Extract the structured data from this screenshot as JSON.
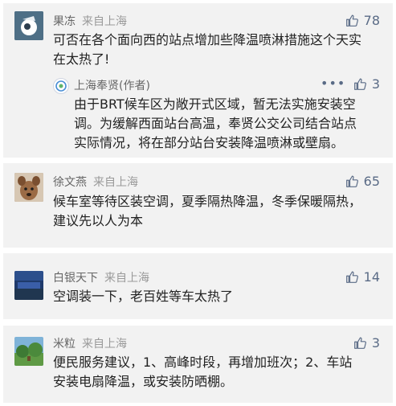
{
  "comments": [
    {
      "user": "果冻",
      "location": "来自上海",
      "likes": "78",
      "text_line1": "可否在各个面向西的站点增加些降温喷淋措施这个天实",
      "text_line2": "在太热了!",
      "reply": {
        "user": "上海奉贤(作者)",
        "menu": "•••",
        "likes": "3",
        "text_line1": "由于BRT候车区为敞开式区域，暂无法实施安装空",
        "text_line2": "调。为缓解西面站台高温，奉贤公交公司结合站点",
        "text_line3": "实际情况，将在部分站台安装降温喷淋或壁扇。"
      }
    },
    {
      "user": "徐文燕",
      "location": "来自上海",
      "likes": "65",
      "text_line1": "候车室等待区装空调，夏季隔热降温，冬季保暖隔热，",
      "text_line2": "建议先以人为本"
    },
    {
      "user": "白银天下",
      "location": "来自上海",
      "likes": "14",
      "text_line1": "空调装一下，老百姓等车太热了"
    },
    {
      "user": "米粒",
      "location": "来自上海",
      "likes": "3",
      "text_line1": "便民服务建议，1、高峰时段，再增加班次；2、车站",
      "text_line2": "安装电扇降温，或安装防晒棚。"
    }
  ]
}
